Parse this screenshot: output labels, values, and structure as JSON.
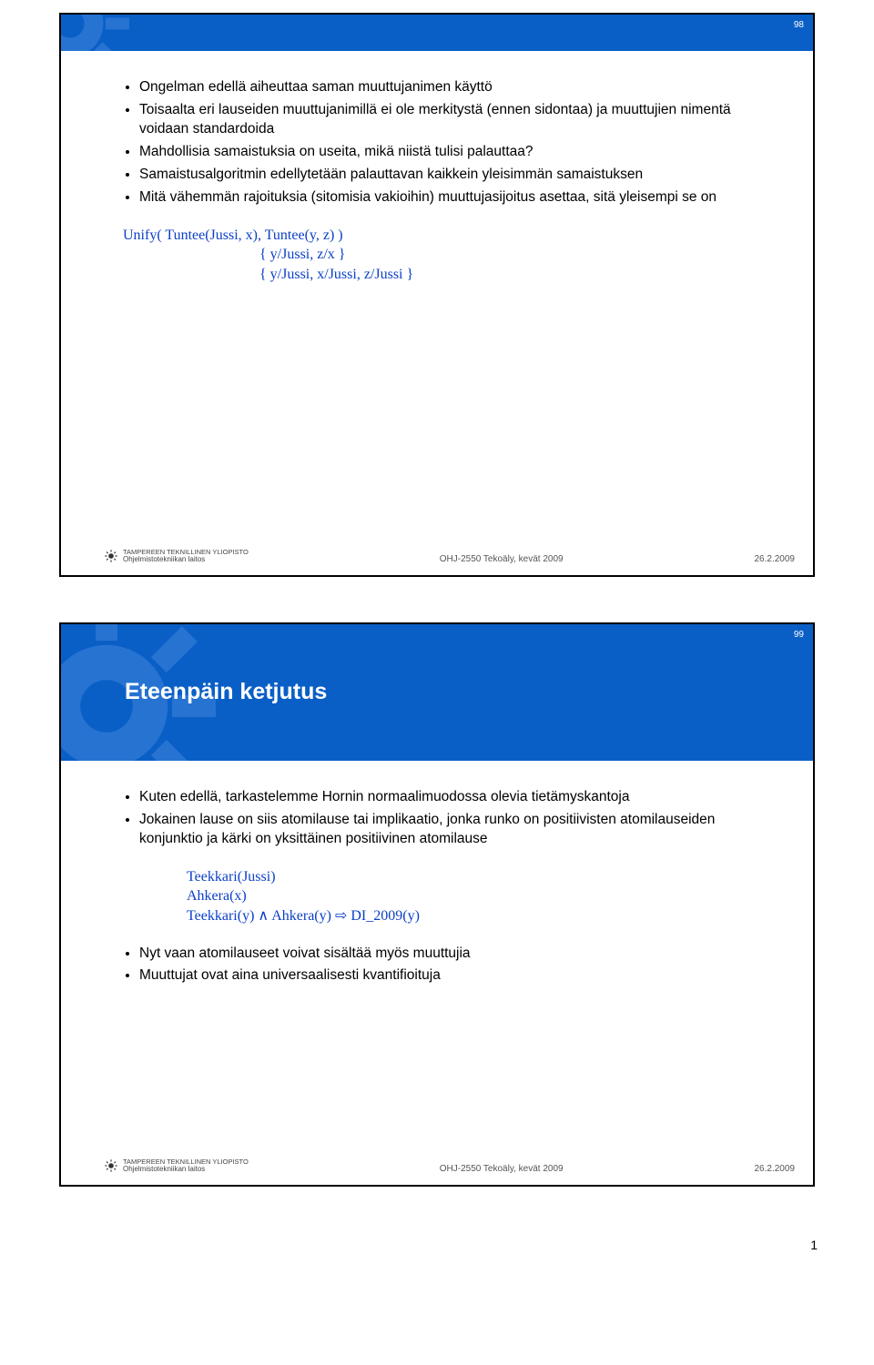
{
  "slide1": {
    "number": "98",
    "bullets": [
      "Ongelman edellä aiheuttaa saman muuttujanimen käyttö",
      "Toisaalta eri lauseiden muuttujanimillä ei ole merkitystä (ennen sidontaa) ja muuttujien nimentä voidaan standardoida",
      "Mahdollisia samaistuksia on useita, mikä niistä tulisi palauttaa?",
      "Samaistusalgoritmin edellytetään palauttavan kaikkein yleisimmän samaistuksen",
      "Mitä vähemmän rajoituksia (sitomisia vakioihin) muuttujasijoitus asettaa, sitä yleisempi se on"
    ],
    "code": {
      "l1": "Unify( Tuntee(Jussi, x), Tuntee(y, z) )",
      "l2": "{ y/Jussi, z/x }",
      "l3": "{ y/Jussi, x/Jussi, z/Jussi }"
    }
  },
  "slide2": {
    "number": "99",
    "title": "Eteenpäin ketjutus",
    "bullets_top": [
      "Kuten edellä, tarkastelemme Hornin normaalimuodossa olevia tietämyskantoja",
      "Jokainen lause on siis atomilause tai implikaatio, jonka runko on positiivisten atomilauseiden konjunktio ja kärki on yksittäinen positiivinen atomilause"
    ],
    "code": {
      "l1": "Teekkari(Jussi)",
      "l2": "Ahkera(x)",
      "l3": "Teekkari(y) ∧ Ahkera(y) ⇨ DI_2009(y)"
    },
    "bullets_bottom": [
      "Nyt vaan atomilauseet voivat sisältää myös muuttujia",
      "Muuttujat ovat aina universaalisesti kvantifioituja"
    ]
  },
  "footer": {
    "uni": "TAMPEREEN TEKNILLINEN YLIOPISTO",
    "dept": "Ohjelmistotekniikan laitos",
    "course": "OHJ-2550 Tekoäly, kevät 2009",
    "date": "26.2.2009"
  },
  "page_number": "1"
}
